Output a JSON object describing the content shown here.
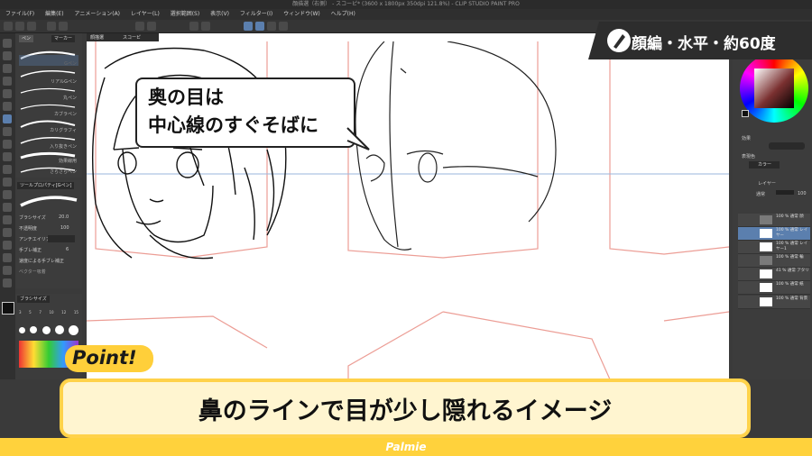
{
  "window": {
    "title": "顔描選（右側） - スコーピ* (3600 x 1800px 350dpi 121.8%) - CLIP STUDIO PAINT PRO"
  },
  "menu": [
    "ファイル(F)",
    "編集(E)",
    "アニメーション(A)",
    "レイヤー(L)",
    "選択範囲(S)",
    "表示(V)",
    "フィルター(I)",
    "ウィンドウ(W)",
    "ヘルプ(H)"
  ],
  "subtool": {
    "tabs": [
      "ペン",
      "マーカー"
    ],
    "brushes": [
      "Gペン",
      "リアルGペン",
      "丸ペン",
      "カブラペン",
      "カリグラフィ",
      "入り抜きペン",
      "効果線用",
      "さらさらペン"
    ]
  },
  "tool_property": {
    "title": "ツールプロパティ[Gペン]",
    "brush_size_label": "ブラシサイズ",
    "brush_size_value": "20.0",
    "opacity_label": "不透明度",
    "opacity_value": "100",
    "antialias_label": "アンチエイリアス",
    "stabilization_label": "手ブレ補正",
    "stabilization_value": "6",
    "speed_label": "速度による手ブレ補正",
    "vector_label": "ベクター吸着"
  },
  "brush_size_panel": {
    "title": "ブラシサイズ",
    "sizes": [
      "3",
      "5",
      "7",
      "10",
      "12",
      "15",
      "17",
      "20",
      "25",
      "30",
      "40",
      "50"
    ]
  },
  "canvas_tabs": [
    "顔描選",
    "スコーピ"
  ],
  "speech_bubble": {
    "text": "奥の目は\n中心線のすぐそばに"
  },
  "banner": {
    "text": "顔編・水平・約60度"
  },
  "point_badge": {
    "text": "Point!"
  },
  "caption": {
    "text": "鼻のラインで目が少し隠れるイメージ"
  },
  "footer": {
    "text": "Palmie"
  },
  "right_panel": {
    "effect_label": "効果",
    "color_label": "表現色",
    "color_value": "カラー",
    "layer_tab": "レイヤー",
    "blend_mode": "通常",
    "opacity": "100",
    "layers": [
      {
        "label": "100 % 通常\n顔"
      },
      {
        "label": "100 % 通常\nレイヤー"
      },
      {
        "label": "100 % 通常\nレイヤー1"
      },
      {
        "label": "100 % 通常\n輪"
      },
      {
        "label": "41 % 通常\nアタリ"
      },
      {
        "label": "100 % 通常\n紙"
      },
      {
        "label": "100 % 通常\n背景"
      }
    ]
  },
  "colors": {
    "accent": "#ffd23c",
    "selected_layer": "#5b7fae",
    "guide_line": "#ec9d95"
  }
}
